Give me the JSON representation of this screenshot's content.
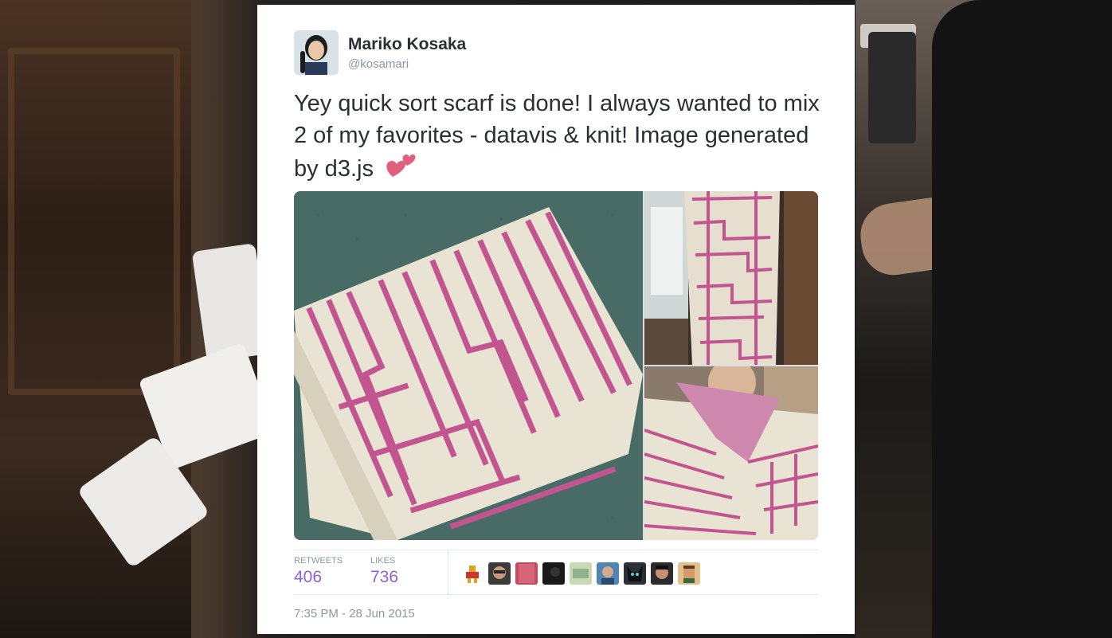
{
  "tweet": {
    "author_name": "Mariko Kosaka",
    "author_handle": "@kosamari",
    "text": "Yey quick sort scarf is done!  I always wanted to mix 2 of my favorites - datavis & knit! Image generated by d3.js",
    "emoji": "two-hearts",
    "retweets_label": "RETWEETS",
    "retweets_count": "406",
    "likes_label": "LIKES",
    "likes_count": "736",
    "timestamp": "7:35 PM - 28 Jun 2015"
  },
  "media": [
    {
      "name": "scarf-folded-photo"
    },
    {
      "name": "scarf-hanging-photo"
    },
    {
      "name": "scarf-worn-photo"
    }
  ],
  "likers": [
    "avatar-1",
    "avatar-2",
    "avatar-3",
    "avatar-4",
    "avatar-5",
    "avatar-6",
    "avatar-7",
    "avatar-8",
    "avatar-9"
  ],
  "colors": {
    "accent": "#8b63d8",
    "text": "#292f33",
    "muted": "#8899a6",
    "scarf_pink": "#c2548f",
    "scarf_cream": "#e8e3d2"
  }
}
